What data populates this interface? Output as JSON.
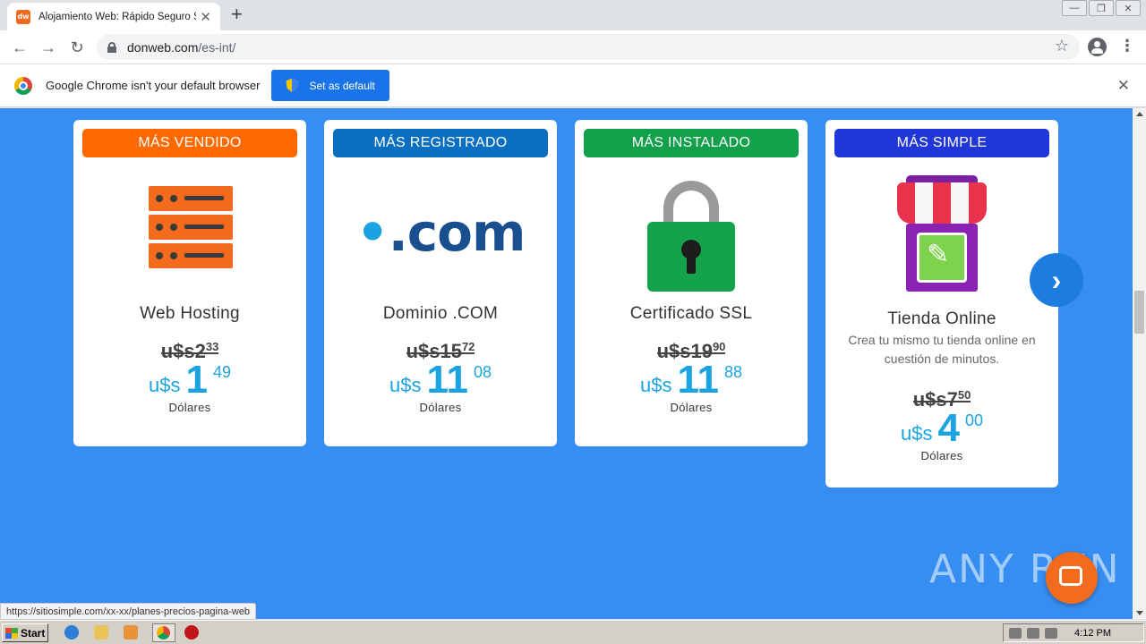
{
  "browser": {
    "tab_title": "Alojamiento Web: Rápido Seguro So",
    "favicon_text": "dw",
    "url_host": "donweb.com",
    "url_path": "/es-int/",
    "infobar_text": "Google Chrome isn't your default browser",
    "set_default_label": "Set as default"
  },
  "cards": [
    {
      "badge": "MÁS VENDIDO",
      "badge_color": "#ff6a00",
      "title": "Web Hosting",
      "old_price": "u$s2",
      "old_cents": "33",
      "currency": "u$s",
      "price_int": "1",
      "price_cents": "49",
      "currency_label": "Dólares"
    },
    {
      "badge": "MÁS REGISTRADO",
      "badge_color": "#0b6fc1",
      "title": "Dominio .COM",
      "illustration_text": ".com",
      "old_price": "u$s15",
      "old_cents": "72",
      "currency": "u$s",
      "price_int": "11",
      "price_cents": "08",
      "currency_label": "Dólares"
    },
    {
      "badge": "MÁS INSTALADO",
      "badge_color": "#12a14a",
      "title": "Certificado SSL",
      "old_price": "u$s19",
      "old_cents": "90",
      "currency": "u$s",
      "price_int": "11",
      "price_cents": "88",
      "currency_label": "Dólares"
    },
    {
      "badge": "MÁS SIMPLE",
      "badge_color": "#2136d6",
      "title": "Tienda Online",
      "description": "Crea tu mismo tu tienda online en cuestión de minutos.",
      "old_price": "u$s7",
      "old_cents": "50",
      "currency": "u$s",
      "price_int": "4",
      "price_cents": "00",
      "currency_label": "Dólares"
    }
  ],
  "icons": {
    "next": "chevron-right-icon",
    "chat": "chat-icon"
  },
  "watermark": "ANY RUN",
  "status_url": "https://sitiosimple.com/xx-xx/planes-precios-pagina-web",
  "taskbar": {
    "start_label": "Start",
    "clock": "4:12 PM"
  }
}
